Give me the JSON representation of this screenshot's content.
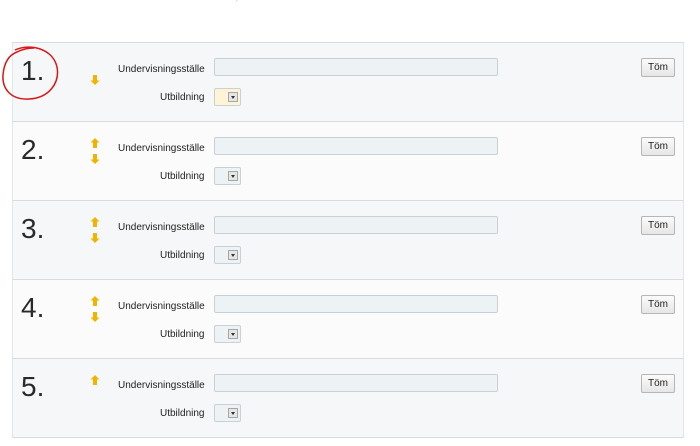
{
  "header": {
    "mark": "'"
  },
  "rows": [
    {
      "number": "1.",
      "place_label": "Undervisningsställe",
      "edu_label": "Utbildning",
      "clear_label": "Töm",
      "has_up": false,
      "has_down": true
    },
    {
      "number": "2.",
      "place_label": "Undervisningsställe",
      "edu_label": "Utbildning",
      "clear_label": "Töm",
      "has_up": true,
      "has_down": true
    },
    {
      "number": "3.",
      "place_label": "Undervisningsställe",
      "edu_label": "Utbildning",
      "clear_label": "Töm",
      "has_up": true,
      "has_down": true
    },
    {
      "number": "4.",
      "place_label": "Undervisningsställe",
      "edu_label": "Utbildning",
      "clear_label": "Töm",
      "has_up": true,
      "has_down": true
    },
    {
      "number": "5.",
      "place_label": "Undervisningsställe",
      "edu_label": "Utbildning",
      "clear_label": "Töm",
      "has_up": true,
      "has_down": false
    }
  ],
  "colors": {
    "arrow": "#f0b400",
    "annotation": "#d81818",
    "highlight_select": "#fff4d6"
  },
  "icons": {
    "up": "arrow-up-icon",
    "down": "arrow-down-icon"
  }
}
